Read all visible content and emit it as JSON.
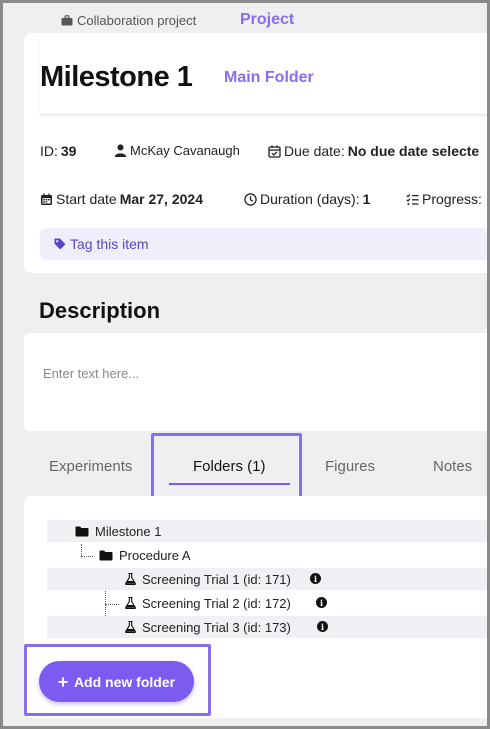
{
  "header": {
    "breadcrumb": "Collaboration project",
    "project_label": "Project"
  },
  "item": {
    "title": "Milestone 1",
    "folder_link": "Main Folder",
    "id_label": "ID:",
    "id_value": "39",
    "owner": "McKay Cavanaugh",
    "due_label": "Due date:",
    "due_value": "No due date selecte",
    "start_label": "Start date",
    "start_value": "Mar 27, 2024",
    "duration_label": "Duration (days):",
    "duration_value": "1",
    "progress_label": "Progress:",
    "tag_label": "Tag this item"
  },
  "description": {
    "title": "Description",
    "placeholder": "Enter text here..."
  },
  "tabs": [
    {
      "label": "Experiments"
    },
    {
      "label": "Folders (1)"
    },
    {
      "label": "Figures"
    },
    {
      "label": "Notes"
    }
  ],
  "tree": {
    "root": "Milestone 1",
    "folder": "Procedure A",
    "trials": [
      {
        "label": "Screening Trial 1 (id: 171)"
      },
      {
        "label": "Screening Trial 2 (id: 172)"
      },
      {
        "label": "Screening Trial 3 (id: 173)"
      }
    ]
  },
  "actions": {
    "add_folder_label": "Add new folder"
  },
  "colors": {
    "accent": "#7c5cf0",
    "link": "#8b6cf0",
    "tag_bg": "#f1eefc"
  }
}
